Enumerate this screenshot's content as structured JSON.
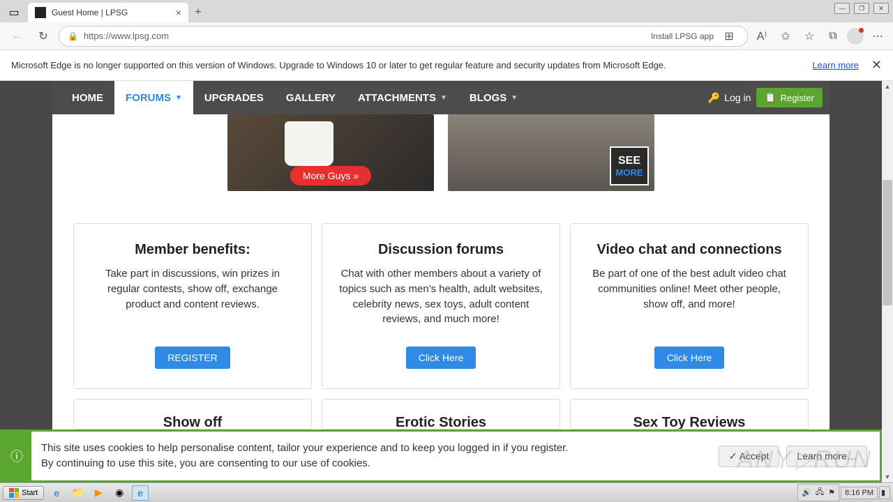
{
  "browser": {
    "tab_title": "Guest Home | LPSG",
    "url": "https://www.lpsg.com",
    "install_app": "Install LPSG app",
    "infobar_text": "Microsoft Edge is no longer supported on this version of Windows. Upgrade to Windows 10 or later to get regular feature and security updates from Microsoft Edge.",
    "learn_more": "Learn more"
  },
  "nav": {
    "home": "HOME",
    "forums": "FORUMS",
    "upgrades": "UPGRADES",
    "gallery": "GALLERY",
    "attachments": "ATTACHMENTS",
    "blogs": "BLOGS",
    "login": "Log in",
    "register": "Register"
  },
  "hero": {
    "more_guys": "More Guys »",
    "see": "SEE",
    "more": "MORE"
  },
  "cards": [
    {
      "title": "Member benefits:",
      "body": "Take part in discussions, win prizes in regular contests, show off, exchange product and content reviews.",
      "button": "REGISTER"
    },
    {
      "title": "Discussion forums",
      "body": "Chat with other members about a variety of topics such as men's health, adult websites, celebrity news, sex toys, adult content reviews, and much more!",
      "button": "Click Here"
    },
    {
      "title": "Video chat and connections",
      "body": "Be part of one of the best adult video chat communities online! Meet other people, show off, and more!",
      "button": "Click Here"
    }
  ],
  "cards2": [
    {
      "title": "Show off"
    },
    {
      "title": "Erotic Stories"
    },
    {
      "title": "Sex Toy Reviews"
    }
  ],
  "cookie": {
    "line1": "This site uses cookies to help personalise content, tailor your experience and to keep you logged in if you register.",
    "line2": "By continuing to use this site, you are consenting to our use of cookies.",
    "accept": "✓ Accept",
    "learn": "Learn more…"
  },
  "watermark": "ANY ▷ RUN",
  "taskbar": {
    "start": "Start",
    "time": "8:16 PM"
  }
}
